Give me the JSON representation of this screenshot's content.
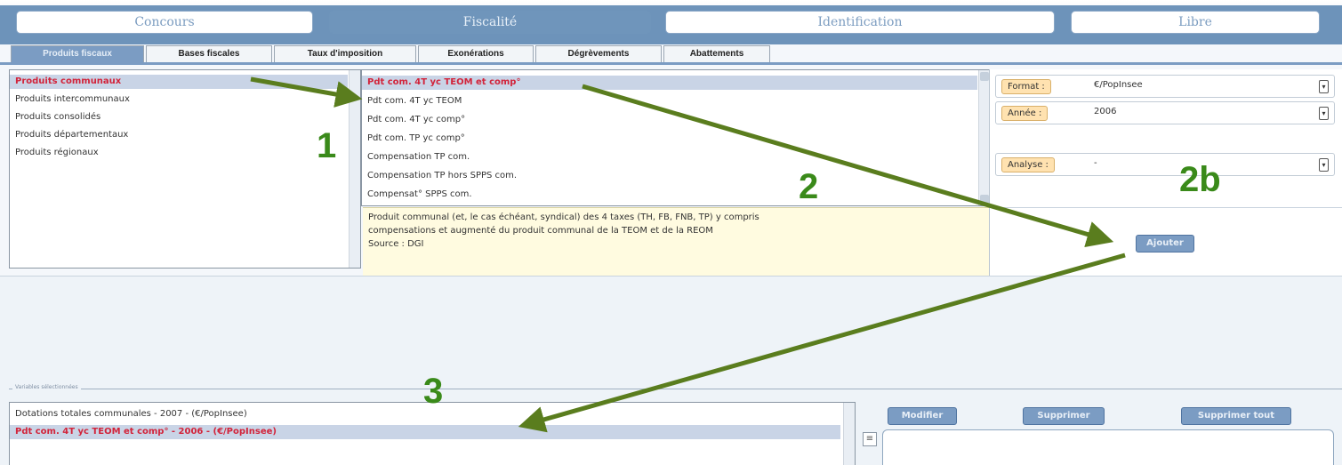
{
  "top_tabs": [
    "Concours",
    "Fiscalité",
    "Identification",
    "Libre"
  ],
  "sub_tabs": [
    "Produits fiscaux",
    "Bases fiscales",
    "Taux d'imposition",
    "Exonérations",
    "Dégrèvements",
    "Abattements"
  ],
  "categories": [
    "Produits communaux",
    "Produits intercommunaux",
    "Produits consolidés",
    "Produits départementaux",
    "Produits régionaux"
  ],
  "variables": [
    "Pdt com. 4T yc TEOM et comp°",
    "Pdt com. 4T yc TEOM",
    "Pdt com. 4T yc comp°",
    "Pdt com. TP yc comp°",
    "Compensation TP com.",
    "Compensation TP hors SPPS com.",
    "Compensat° SPPS com."
  ],
  "description": {
    "line1": "Produit communal (et, le cas échéant, syndical) des 4 taxes (TH, FB, FNB, TP) y compris",
    "line2": "compensations et augmenté du produit communal de la TEOM et de la REOM",
    "line3": "Source : DGI"
  },
  "options": {
    "format_label": "Format :",
    "format_value": "€/PopInsee",
    "annee_label": "Année :",
    "annee_value": "2006",
    "analyse_label": "Analyse :",
    "analyse_value": "-",
    "dropdown_glyph": "▾"
  },
  "buttons": {
    "ajouter": "Ajouter",
    "modifier": "Modifier",
    "supprimer": "Supprimer",
    "supprimer_tout": "Supprimer tout",
    "list_toggle": "≡"
  },
  "selected_section_title": "Variables sélectionnées",
  "selected_variables": [
    "Dotations totales communales - 2007 - (€/PopInsee)",
    "Pdt com. 4T yc TEOM et comp° - 2006 - (€/PopInsee)"
  ],
  "annotations": [
    "1",
    "2",
    "2b",
    "3"
  ],
  "colors": {
    "accent": "#7b9cc3",
    "selected_text": "#d2233a",
    "arrow": "#5a7d1e",
    "annotation": "#3a8a1a",
    "description_bg": "#fffbe0"
  }
}
